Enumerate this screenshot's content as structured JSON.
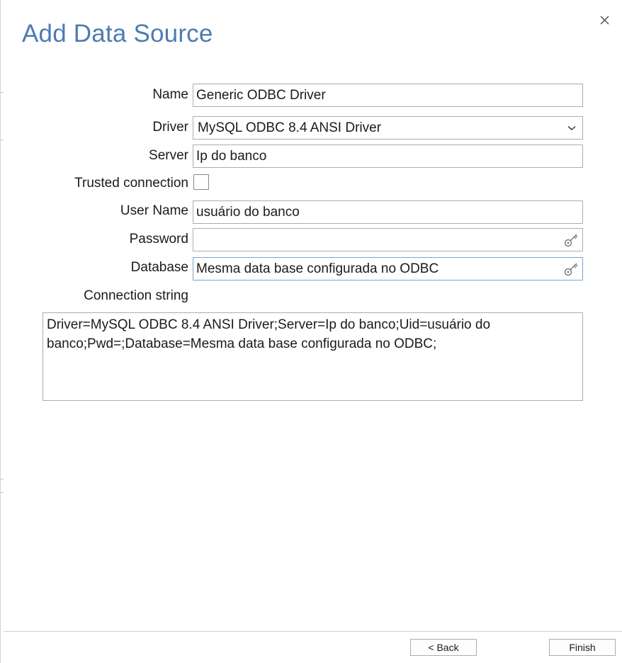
{
  "dialog": {
    "title": "Add Data Source",
    "close_icon": "close-icon"
  },
  "form": {
    "name_label": "Name",
    "name_value": "Generic ODBC Driver",
    "driver_label": "Driver",
    "driver_value": "MySQL ODBC 8.4 ANSI Driver",
    "server_label": "Server",
    "server_value": "Ip do banco",
    "trusted_label": "Trusted connection",
    "trusted_checked": false,
    "username_label": "User Name",
    "username_value": "usuário do banco",
    "password_label": "Password",
    "password_value": "",
    "database_label": "Database",
    "database_value": "Mesma data base configurada no ODBC",
    "connstring_label": "Connection string",
    "connstring_value": "Driver=MySQL ODBC 8.4 ANSI Driver;Server=Ip do banco;Uid=usuário do banco;Pwd=;Database=Mesma data base configurada no ODBC;"
  },
  "footer": {
    "back_label": "< Back",
    "finish_label": "Finish"
  },
  "colors": {
    "title": "#4d7cb3",
    "focused_border": "#7ea2d0",
    "border": "#acacac"
  }
}
